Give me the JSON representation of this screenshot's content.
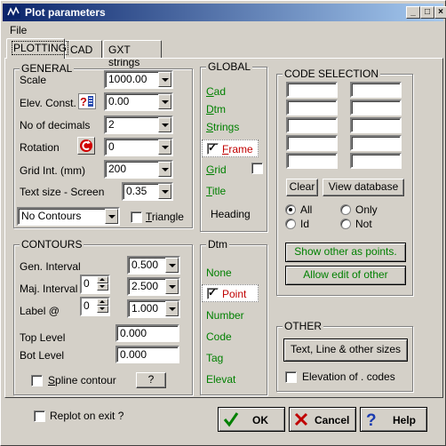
{
  "window": {
    "title": "Plot parameters"
  },
  "menu": {
    "file": "File"
  },
  "tabs": [
    "PLOTTING",
    "CAD",
    "GXT strings"
  ],
  "general": {
    "title": "GENERAL",
    "scale_label": "Scale",
    "scale_value": "1000.00",
    "elev_label": "Elev. Const.",
    "elev_value": "0.00",
    "decimals_label": "No of decimals",
    "decimals_value": "2",
    "rotation_label": "Rotation",
    "rotation_value": "0",
    "grid_label": "Grid Int. (mm)",
    "grid_value": "200",
    "textsize_label": "Text size - Screen",
    "textsize_value": "0.35",
    "contours_combo": "No Contours",
    "triangle_label": "Triangle"
  },
  "contours": {
    "title": "CONTOURS",
    "gen_label": "Gen. Interval",
    "gen_value": "0.500",
    "maj_label": "Maj. Interval",
    "maj_spin": "0",
    "maj_value": "2.500",
    "label_label": "Label @",
    "label_spin": "0",
    "label_value": "1.000",
    "top_label": "Top Level",
    "top_value": "0.000",
    "bot_label": "Bot Level",
    "bot_value": "0.000",
    "spline_label": "Spline contour",
    "help_btn": "?"
  },
  "global": {
    "title": "GLOBAL",
    "items": [
      "Cad",
      "Dtm",
      "Strings",
      "Frame",
      "Grid",
      "Title",
      "Heading"
    ]
  },
  "dtm": {
    "title": "Dtm",
    "items": [
      "None",
      "Point",
      "Number",
      "Code",
      "Tag",
      "Elevat"
    ]
  },
  "code_selection": {
    "title": "CODE SELECTION",
    "clear": "Clear",
    "view": "View database",
    "radio_all": "All",
    "radio_only": "Only",
    "radio_id": "Id",
    "radio_not": "Not",
    "show_other": "Show other as points.",
    "allow_edit": "Allow edit of other"
  },
  "other": {
    "title": "OTHER",
    "sizes_btn": "Text, Line & other sizes",
    "elevation_label": "Elevation of . codes"
  },
  "footer": {
    "replot_label": "Replot on exit ?",
    "ok": "OK",
    "cancel": "Cancel",
    "help": "Help"
  }
}
